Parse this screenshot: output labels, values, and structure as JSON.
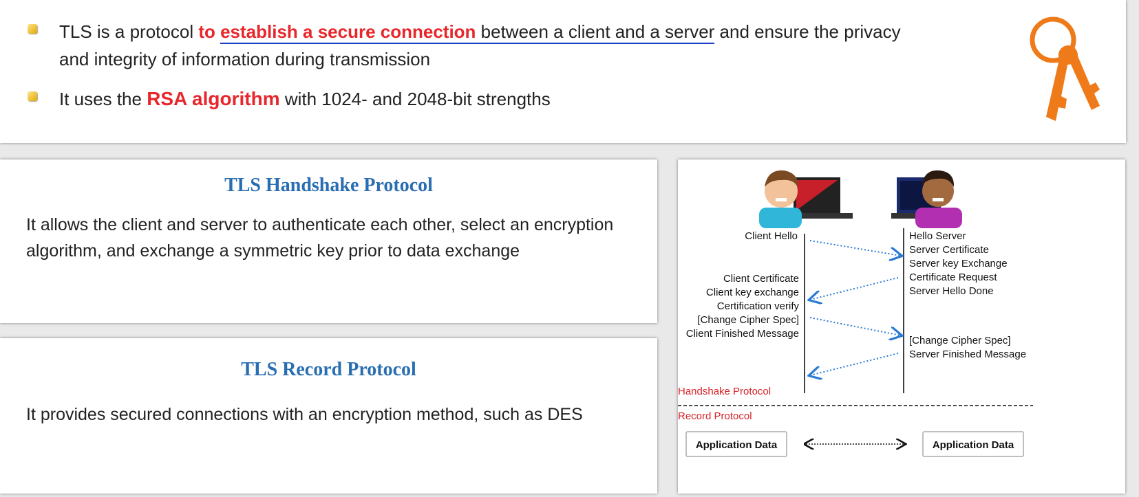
{
  "bullets": {
    "b1": {
      "pre": "TLS is a protocol ",
      "hl1": "to ",
      "hl2": "establish a secure connection",
      "mid": " between a client and a server",
      "post": " and ensure the privacy",
      "line2": "and integrity of information during transmission"
    },
    "b2": {
      "pre": "It uses the ",
      "hl": "RSA algorithm",
      "post": " with 1024- and 2048-bit strengths"
    }
  },
  "handshake": {
    "title": "TLS Handshake Protocol",
    "body": "It allows the client and server to authenticate each other, select an encryption algorithm, and exchange a symmetric key prior to data exchange"
  },
  "record": {
    "title": "TLS Record Protocol",
    "body": "It provides secured connections with an encryption method, such as DES"
  },
  "diagram": {
    "client_msgs": {
      "hello": "Client Hello",
      "group": [
        "Client Certificate",
        "Client key exchange",
        "Certification verify",
        "[Change Cipher Spec]",
        "Client Finished Message"
      ]
    },
    "server_msgs": {
      "group1": [
        "Hello Server",
        "Server Certificate",
        "Server key Exchange",
        "Certificate Request",
        "Server Hello Done"
      ],
      "group2": [
        "[Change Cipher Spec]",
        "Server Finished Message"
      ]
    },
    "handshake_label": "Handshake Protocol",
    "record_label": "Record Protocol",
    "app_data_left": "Application Data",
    "app_data_right": "Application Data",
    "colors": {
      "arrow": "#2a7bd4",
      "protocol_label": "#d8232a",
      "title": "#2a6eb2"
    }
  },
  "icons": {
    "keys": "keys-icon",
    "client": "client-avatar-icon",
    "server": "server-avatar-icon"
  }
}
